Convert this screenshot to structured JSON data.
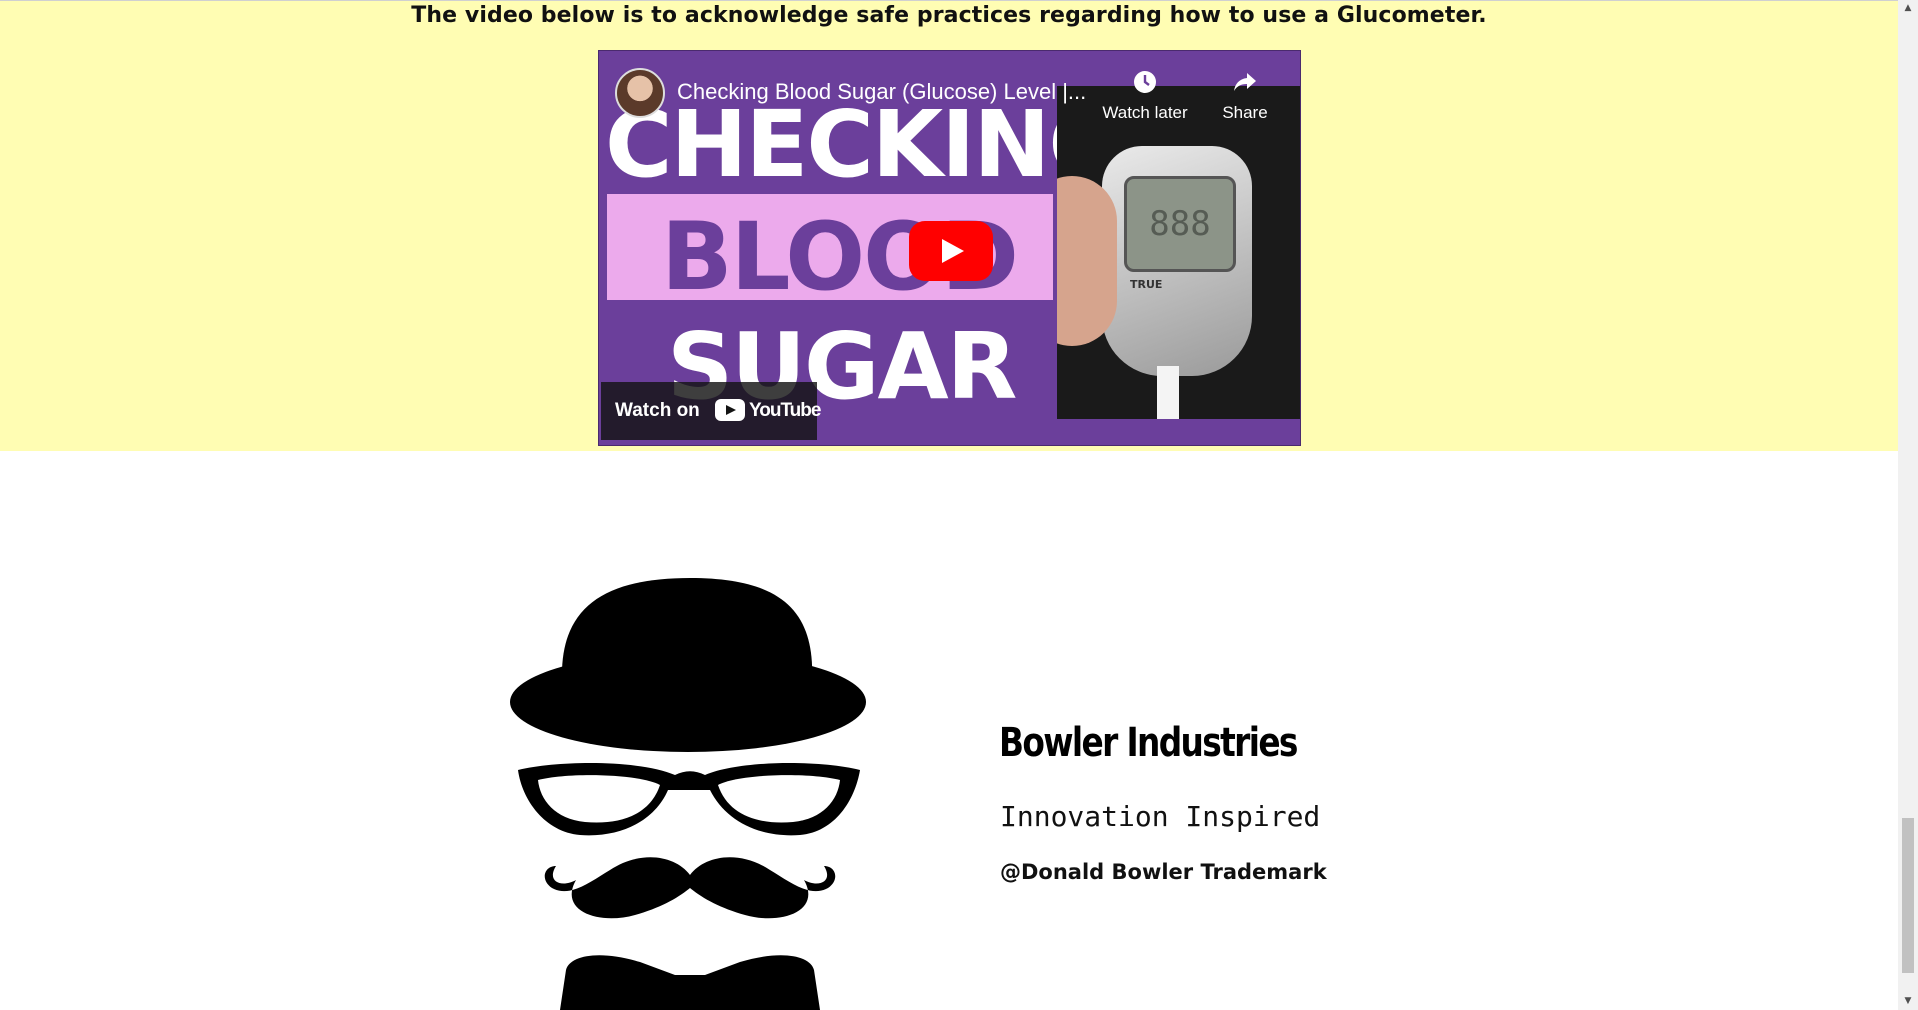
{
  "intro_text": "The video below is to acknowledge safe practices regarding how to use a Glucometer.",
  "video": {
    "title": "Checking Blood Sugar (Glucose) Level |...",
    "thumbnail_words": [
      "CHECKING",
      "BLOOD",
      "SUGAR"
    ],
    "meter_display": "888",
    "meter_brand": "TRUE",
    "watch_later_label": "Watch later",
    "share_label": "Share",
    "watch_on_label": "Watch on",
    "youtube_label": "YouTube",
    "play_color": "#ff0000"
  },
  "brand": {
    "name": "Bowler Industries",
    "tagline": "Innovation Inspired",
    "trademark": "@Donald Bowler Trademark"
  },
  "colors": {
    "section_background": "#fffdb3",
    "thumbnail_purple": "#6b3f9b",
    "thumbnail_pink": "#ecaaec"
  },
  "icons": [
    "clock-icon",
    "share-arrow-icon",
    "play-icon",
    "youtube-logo-icon",
    "bowler-hat-logo-icon"
  ]
}
